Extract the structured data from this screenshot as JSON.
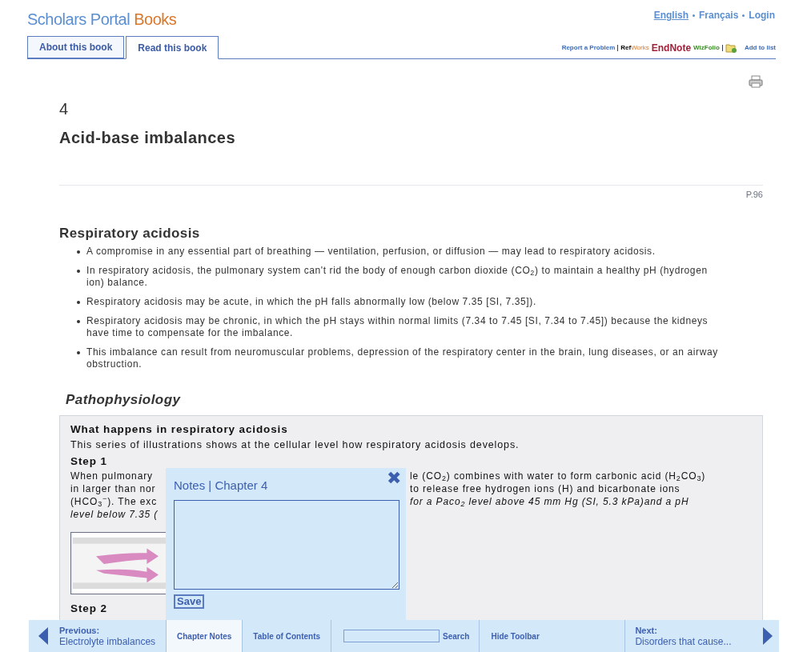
{
  "header": {
    "logo": [
      "Scholars Portal",
      "Books"
    ],
    "languages": [
      {
        "label": "English",
        "selected": true
      },
      {
        "label": "Français",
        "selected": false
      },
      {
        "label": "Login",
        "selected": false
      }
    ],
    "tabs": [
      {
        "label": "About this book",
        "selected": false
      },
      {
        "label": "Read this book",
        "selected": true
      }
    ],
    "tools": {
      "report": "Report a Problem",
      "refworks": [
        "Ref",
        "Works"
      ],
      "endnote": "EndNote",
      "wizfolio": "WizFolio",
      "add": "Add to list"
    }
  },
  "chapter": {
    "number": "4",
    "title": "Acid-base imbalances",
    "page": "P.96"
  },
  "section": {
    "title": "Respiratory acidosis",
    "bullets": [
      "A compromise in any essential part of breathing — ventilation, perfusion, or diffusion — may lead to respiratory acidosis.",
      "In respiratory acidosis, the pulmonary system can't rid the body of enough carbon dioxide (CO$_{2}$) to maintain a healthy pH (hydrogen ion) balance.",
      "Respiratory acidosis may be acute, in which the pH falls abnormally low (below 7.35 [SI, 7.35]).",
      "Respiratory acidosis may be chronic, in which the pH stays within normal limits (7.34 to 7.45 [SI, 7.34 to 7.45]) because the kidneys have time to compensate for the imbalance.",
      "This imbalance can result from neuromuscular problems, depression of the respiratory center in the brain, lung diseases, or an airway obstruction."
    ]
  },
  "subsection": {
    "title": "Pathophysiology",
    "box_title": "What happens in respiratory acidosis",
    "intro": "This series of illustrations shows at the cellular level how respiratory acidosis develops.",
    "steps": [
      {
        "title": "Step 1",
        "lines": [
          {
            "left": "When pulmonary",
            "right": "le (CO$_{2}$) combines with water to form carbonic acid (H$_{2}$CO$_{3}$)"
          },
          {
            "left": "in larger than nor",
            "right": "to release free hydrogen ions (H) and bicarbonate ions"
          },
          {
            "left": "(HCO$_{3}$$^{−}$). The exc",
            "right": "*for a Paco$_{2}$ level above 45 mm Hg (SI, 5.3 kPa)and a pH*"
          },
          {
            "left": "*level below 7.35 (*"
          }
        ],
        "figure": {
          "kind": "picture"
        }
      },
      {
        "title": "Step 2"
      }
    ]
  },
  "notes": {
    "title": "Notes | Chapter 4",
    "close": "✖",
    "save": "Save"
  },
  "toolbar": {
    "previous_label": "Previous:",
    "previous": "Electrolyte imbalances",
    "items": [
      {
        "label": "Chapter Notes",
        "selected": true
      },
      {
        "label": "Table of Contents",
        "selected": false
      }
    ],
    "search": "Search",
    "hide": "Hide Toolbar",
    "next_label": "Next:",
    "next": "Disorders that cause..."
  }
}
